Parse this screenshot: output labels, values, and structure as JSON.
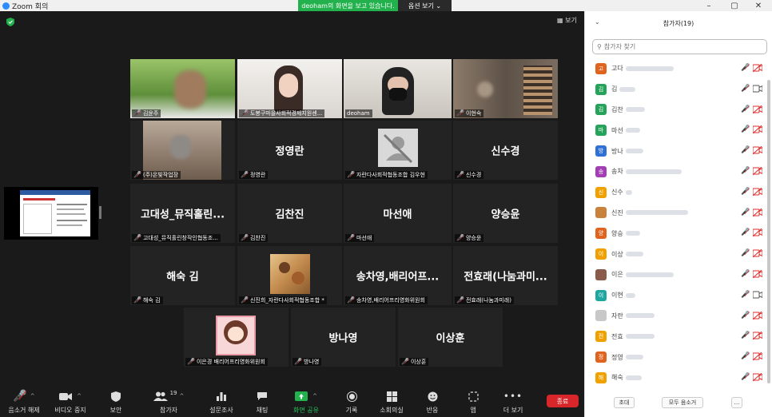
{
  "window": {
    "title": "Zoom 회의",
    "minimize": "–",
    "maximize": "▢",
    "close": "✕"
  },
  "share_banner": {
    "text": "deoham의 화면을 보고 있습니다.",
    "view_options": "옵션 보기 ⌄"
  },
  "view_button": "보기",
  "tiles": [
    {
      "bigname": "",
      "label": "김윤주",
      "video": true
    },
    {
      "bigname": "",
      "label": "도봉구마을사회적경제지원센...",
      "video": true
    },
    {
      "bigname": "",
      "label": "deoham",
      "video": true
    },
    {
      "bigname": "",
      "label": "이현숙",
      "video": true
    },
    {
      "bigname": "",
      "label": "(주)온빛작업장",
      "video": true
    },
    {
      "bigname": "정영란",
      "label": "정영란",
      "video": false
    },
    {
      "bigname": "",
      "label": "자란다사회적협동조합 김우현",
      "video": false
    },
    {
      "bigname": "신수경",
      "label": "신수경",
      "video": false
    },
    {
      "bigname": "고대성_뮤직홀린...",
      "label": "고대성_뮤직홀린창작인협동조...",
      "video": false
    },
    {
      "bigname": "김찬진",
      "label": "김찬진",
      "video": false
    },
    {
      "bigname": "마선애",
      "label": "마선애",
      "video": false
    },
    {
      "bigname": "양승윤",
      "label": "양승윤",
      "video": false
    },
    {
      "bigname": "해숙 김",
      "label": "해숙 김",
      "video": false
    },
    {
      "bigname": "",
      "label": "신진희_자란다사회적협동조합 *",
      "video": false
    },
    {
      "bigname": "송차영,배리어프...",
      "label": "송차영,배리어프리영화위원회",
      "video": false
    },
    {
      "bigname": "전효래(나눔과미...",
      "label": "전효래(나눔과미래)",
      "video": false
    },
    {
      "bigname": "",
      "label": "이은경 배리어프리영화위원회",
      "video": false
    },
    {
      "bigname": "방나영",
      "label": "방나영",
      "video": false
    },
    {
      "bigname": "이상훈",
      "label": "이상훈",
      "video": false
    }
  ],
  "toolbar": {
    "mute": "음소거 해제",
    "video": "비디오 중지",
    "security": "보안",
    "participants": "참가자",
    "participants_count": "19",
    "polls": "설문조사",
    "chat": "채팅",
    "share": "화면 공유",
    "record": "기록",
    "breakout": "소회의실",
    "reactions": "반응",
    "apps": "앱",
    "more": "더 보기",
    "end": "종료"
  },
  "panel": {
    "title": "참가자(19)",
    "search_placeholder": "참가자 찾기",
    "participants": [
      {
        "initial": "고",
        "name": "고다",
        "color": "#e0641e",
        "video_off": true
      },
      {
        "initial": "김",
        "name": "김",
        "color": "#25a35a",
        "video_off": false
      },
      {
        "initial": "김",
        "name": "김찬",
        "color": "#25a35a",
        "video_off": true
      },
      {
        "initial": "마",
        "name": "마선",
        "color": "#25a35a",
        "video_off": true
      },
      {
        "initial": "방",
        "name": "방나",
        "color": "#2f6fd6",
        "video_off": true
      },
      {
        "initial": "송",
        "name": "송차",
        "color": "#a23fb4",
        "video_off": true
      },
      {
        "initial": "신",
        "name": "신수",
        "color": "#f0a100",
        "video_off": true
      },
      {
        "initial": "",
        "name": "신진",
        "color": "#c8823b",
        "video_off": true
      },
      {
        "initial": "양",
        "name": "양승",
        "color": "#e0641e",
        "video_off": true
      },
      {
        "initial": "이",
        "name": "이상",
        "color": "#f0a100",
        "video_off": true
      },
      {
        "initial": "",
        "name": "이은",
        "color": "#8a5a4a",
        "video_off": true
      },
      {
        "initial": "이",
        "name": "이현",
        "color": "#1ea6a0",
        "video_off": false
      },
      {
        "initial": "",
        "name": "자란",
        "color": "#c8c8c8",
        "video_off": true
      },
      {
        "initial": "전",
        "name": "전효",
        "color": "#f0a100",
        "video_off": true
      },
      {
        "initial": "정",
        "name": "정영",
        "color": "#e0641e",
        "video_off": true
      },
      {
        "initial": "해",
        "name": "해숙",
        "color": "#f0a100",
        "video_off": true
      }
    ],
    "invite": "초대",
    "mute_all": "모두 음소거",
    "more": "..."
  }
}
